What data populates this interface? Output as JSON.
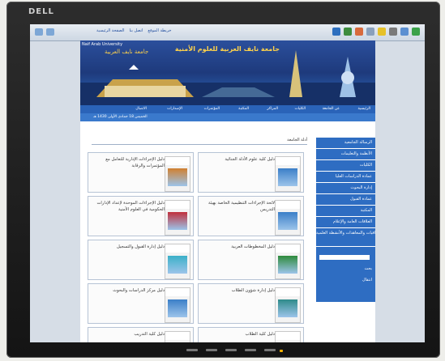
{
  "monitor": {
    "brand": "DELL"
  },
  "browser": {
    "links": [
      "الصفحة الرئيسية",
      "اتصل بنا",
      "خريطة الموقع"
    ],
    "toolbar_icons": [
      "help-icon",
      "globe-icon",
      "settings-icon",
      "star-icon",
      "print-icon",
      "mail-icon",
      "home-icon",
      "refresh-icon"
    ]
  },
  "site": {
    "name": "جامعة نايف العربية للعلوم الأمنية",
    "name_short": "جامعة نايف العربية",
    "tagline": "للعلوم الأمنية",
    "subtitle": "Naif Arab University",
    "nav": [
      "الرئيسية",
      "عن الجامعة",
      "الكليات",
      "المراكز",
      "المكتبة",
      "المؤتمرات",
      "الإصدارات",
      "الاتصال"
    ],
    "date_line": "الخميس 18 جمادى الأولى 1430 هـ",
    "main_heading": "أدلة الجامعة",
    "sidebar": [
      "الرسالة الجامعية",
      "الأنظمة والتعليمات",
      "الكليات",
      "عمادة الدراسات العليا",
      "إدارة البحوث",
      "عمادة القبول",
      "المكتبة",
      "العلاقات العامة والإعلام",
      "الإتفاقيات والمعاهدات والأنشطة العلمية"
    ],
    "search": {
      "label": "بحث",
      "go": "انتقال"
    },
    "cards": [
      {
        "title": "دليل كلية علوم الأدلة الجنائية",
        "col": 0,
        "row": 0
      },
      {
        "title": "دليل الإجراءات الإدارية للتعامل مع المؤتمرات والرقابة",
        "col": 1,
        "row": 0
      },
      {
        "title": "لائحة الإجراءات التنظيمية الخاصة بهيئة التدريس",
        "col": 0,
        "row": 1
      },
      {
        "title": "دليل الإجراءات الموحدة لإعداد الإدارات الحكومية في العلوم الأمنية",
        "col": 1,
        "row": 1
      },
      {
        "title": "دليل المخطوطات العربية",
        "col": 0,
        "row": 2
      },
      {
        "title": "دليل إدارة القبول والتسجيل",
        "col": 1,
        "row": 2
      },
      {
        "title": "دليل إدارة شؤون الطلاب",
        "col": 0,
        "row": 3
      },
      {
        "title": "دليل مركز الدراسات والبحوث",
        "col": 1,
        "row": 3
      },
      {
        "title": "دليل كلية الطلاب",
        "col": 0,
        "row": 4
      },
      {
        "title": "دليل كلية التدريب",
        "col": 1,
        "row": 4
      }
    ]
  },
  "colors": {
    "accent": "#2e6dc2",
    "banner": "#1e3a7c",
    "gold": "#ffd24a"
  }
}
